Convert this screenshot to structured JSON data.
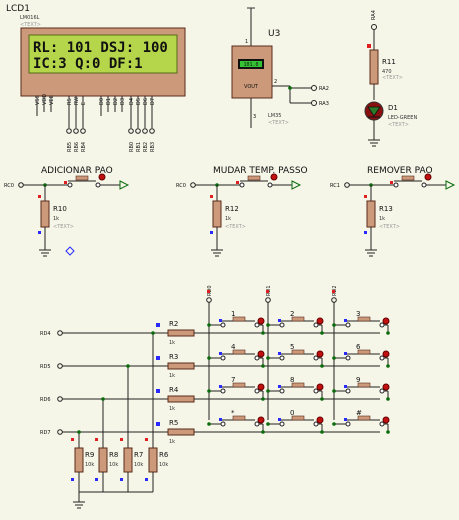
{
  "lcd": {
    "ref": "LCD1",
    "model": "LM016L",
    "text_tag": "<TEXT>",
    "line1": "RL: 101 DSJ: 100",
    "line2": "IC:3  Q:0  DF:1",
    "pins": [
      "VSS",
      "VDD",
      "VEE",
      "RS",
      "RW",
      "E",
      "D0",
      "D1",
      "D2",
      "D3",
      "D4",
      "D5",
      "D6",
      "D7"
    ],
    "net_labels": [
      "RB5",
      "RB6",
      "RB4",
      "RB0",
      "RB1",
      "RB2",
      "RB3"
    ]
  },
  "sensor": {
    "ref": "U3",
    "model": "LM35",
    "text_tag": "<TEXT>",
    "reading": "101.0",
    "vout": "VOUT",
    "pin1": "1",
    "pin2": "2",
    "pin3": "3",
    "nets": [
      "RA2",
      "RA3"
    ],
    "top_net": "RA4"
  },
  "led": {
    "resistor_ref": "R11",
    "resistor_value": "470",
    "resistor_text": "<TEXT>",
    "ref": "D1",
    "model": "LED-GREEN",
    "text_tag": "<TEXT>"
  },
  "buttons": [
    {
      "label": "ADICIONAR PAO",
      "net": "RC0",
      "resistor": "R10",
      "value": "1k",
      "text": "<TEXT>"
    },
    {
      "label": "MUDAR TEMP. PASSO",
      "net": "RC0",
      "resistor": "R12",
      "value": "1k",
      "text": "<TEXT>"
    },
    {
      "label": "REMOVER PAO",
      "net": "RC1",
      "resistor": "R13",
      "value": "1k",
      "text": "<TEXT>"
    }
  ],
  "keypad": {
    "col_nets": [
      "RD0",
      "RD1",
      "RD2"
    ],
    "row_nets": [
      "RD4",
      "RD5",
      "RD6",
      "RD7"
    ],
    "row_resistors": [
      {
        "ref": "R2",
        "value": "1k"
      },
      {
        "ref": "R3",
        "value": "1k"
      },
      {
        "ref": "R4",
        "value": "1k"
      },
      {
        "ref": "R5",
        "value": "1k"
      }
    ],
    "keys": [
      "1",
      "2",
      "3",
      "4",
      "5",
      "6",
      "7",
      "8",
      "9",
      "*",
      "0",
      "#"
    ],
    "pulldowns": [
      {
        "ref": "R9",
        "value": "10k"
      },
      {
        "ref": "R8",
        "value": "10k"
      },
      {
        "ref": "R7",
        "value": "10k"
      },
      {
        "ref": "R6",
        "value": "10k"
      }
    ]
  }
}
